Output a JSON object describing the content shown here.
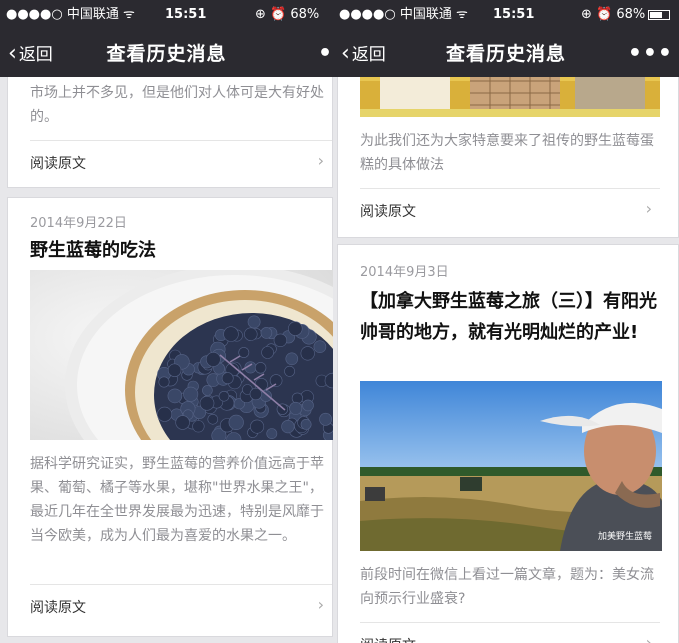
{
  "status_bar": {
    "carrier": "●●●●○ 中国联通 ᯤ",
    "time": "15:51",
    "battery": "⊕ ⏰ 68%"
  },
  "nav": {
    "back_label": "返回",
    "title": "查看历史消息",
    "more": "•••"
  },
  "left": {
    "card1": {
      "summary": "市场上并不多见，但是他们对人体可是大有好处的。",
      "read": "阅读原文"
    },
    "card2": {
      "date": "2014年9月22日",
      "title": "野生蓝莓的吃法",
      "summary": "据科学研究证实，野生蓝莓的营养价值远高于苹果、葡萄、橘子等水果，堪称\"世界水果之王\"，最近几年在全世界发展最为迅速，特别是风靡于当今欧美，成为人们最为喜爱的水果之一。",
      "read": "阅读原文"
    }
  },
  "right": {
    "card1": {
      "summary": "为此我们还为大家特意要来了祖传的野生蓝莓蛋糕的具体做法",
      "read": "阅读原文"
    },
    "card2": {
      "date": "2014年9月3日",
      "title": "【加拿大野生蓝莓之旅（三）】有阳光帅哥的地方，就有光明灿烂的产业!",
      "watermark": "加美野生蓝莓",
      "summary": "前段时间在微信上看过一篇文章，题为：美女流向预示行业盛衰?",
      "read": "阅读原文"
    }
  },
  "icons": {
    "back": "chevron-left-icon",
    "more": "more-dots-icon",
    "read_arrow": "chevron-right-icon"
  },
  "colors": {
    "navbar": "#2b2a30",
    "background": "#e7e7ea",
    "summary_text": "#8f8f94"
  }
}
